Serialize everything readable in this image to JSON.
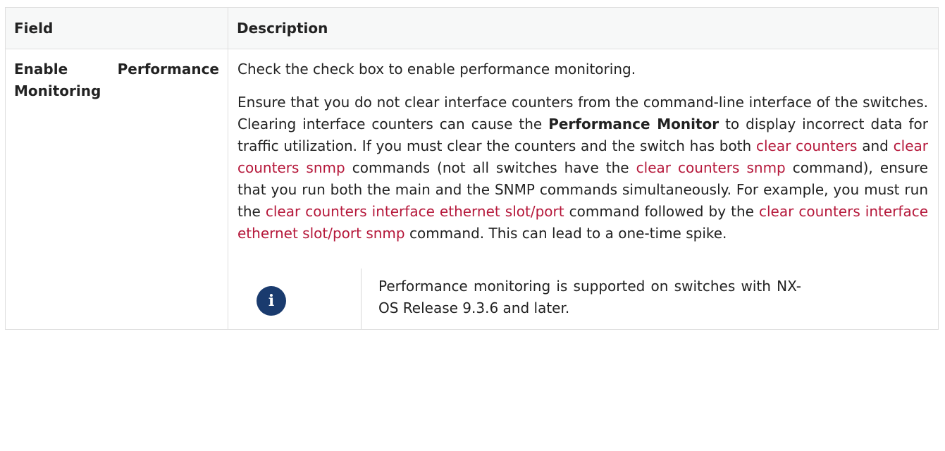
{
  "table": {
    "headers": [
      "Field",
      "Description"
    ],
    "row": {
      "field": "Enable Performance Monitoring",
      "paragraph1": "Check the check box to enable performance monitoring.",
      "paragraph2": {
        "t1": "Ensure that you do not clear interface counters from the command-line interface of the switches. Clearing interface counters can cause the ",
        "bold1": "Performance Monitor",
        "t2": " to display incorrect data for traffic utilization. If you must clear the counters and the switch has both ",
        "cmd1": "clear counters",
        "t3": " and ",
        "cmd2": "clear counters snmp",
        "t4": " commands (not all switches have the ",
        "cmd3": "clear counters snmp",
        "t5": " command), ensure that you run both the main and the SNMP commands simultaneously. For example, you must run the ",
        "cmd4": "clear counters interface ethernet slot/port",
        "t6": " command followed by the ",
        "cmd5": "clear counters interface ethernet slot/port snmp",
        "t7": " command. This can lead to a one-time spike."
      },
      "note": {
        "icon": "info-icon",
        "icon_glyph": "i",
        "text": "Performance monitoring is supported on switches with NX-OS Release 9.3.6 and later."
      }
    }
  },
  "colors": {
    "command_link": "#b5173a",
    "note_icon_bg": "#1a3b6e",
    "header_bg": "#f7f8f8",
    "border": "#dedede"
  }
}
